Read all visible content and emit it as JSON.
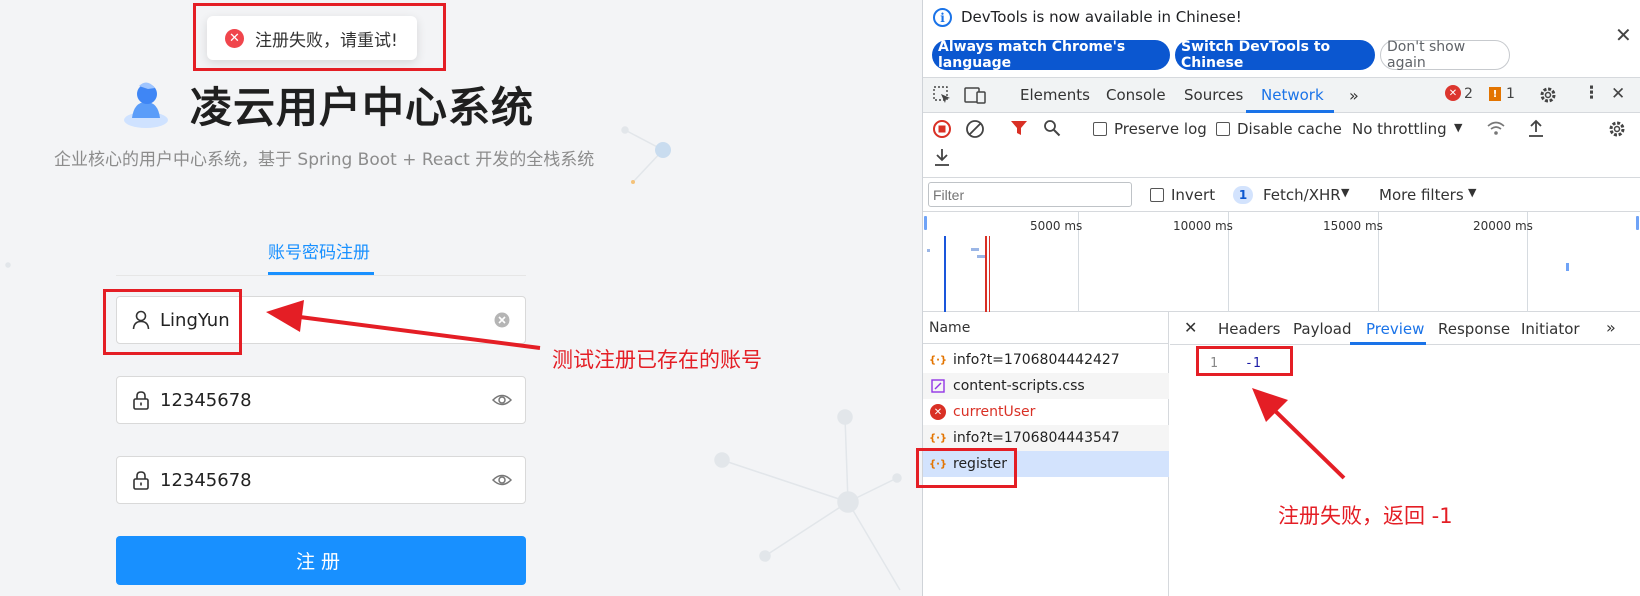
{
  "app": {
    "toast_message": "注册失败，请重试!",
    "title": "凌云用户中心系统",
    "subtitle": "企业核心的用户中心系统，基于 Spring Boot + React 开发的全栈系统",
    "tab_label": "账号密码注册",
    "username_value": "LingYun",
    "password_value": "12345678",
    "confirm_password_value": "12345678",
    "submit_label": "注册",
    "brand_color": "#1890ff"
  },
  "devtools": {
    "info_text": "DevTools is now available in Chinese!",
    "btn_match_language": "Always match Chrome's language",
    "btn_switch_chinese": "Switch DevTools to Chinese",
    "btn_dont_show": "Don't show again",
    "tabs": [
      "Elements",
      "Console",
      "Sources",
      "Network"
    ],
    "active_tab": "Network",
    "error_count": "2",
    "warning_count": "1",
    "preserve_log": "Preserve log",
    "disable_cache": "Disable cache",
    "throttling": "No throttling",
    "filter_placeholder": "Filter",
    "invert": "Invert",
    "resource_filter_count": "1",
    "resource_filter": "Fetch/XHR",
    "more_filters": "More filters",
    "timeline_ticks": [
      "5000 ms",
      "10000 ms",
      "15000 ms",
      "20000 ms"
    ],
    "name_header": "Name",
    "requests": [
      {
        "name": "info?t=1706804442427",
        "status": "ok",
        "icon": "xhr-icon"
      },
      {
        "name": "content-scripts.css",
        "status": "ok",
        "icon": "stylesheet-icon"
      },
      {
        "name": "currentUser",
        "status": "error",
        "icon": "error-icon"
      },
      {
        "name": "info?t=1706804443547",
        "status": "ok",
        "icon": "xhr-icon"
      },
      {
        "name": "register",
        "status": "selected",
        "icon": "xhr-icon"
      }
    ],
    "detail_tabs": [
      "Headers",
      "Payload",
      "Preview",
      "Response",
      "Initiator"
    ],
    "active_detail_tab": "Preview",
    "preview_line_number": "1",
    "preview_value": "-1"
  },
  "annotations": {
    "existing_account_note": "测试注册已存在的账号",
    "register_failed_note": "注册失败，返回 -1",
    "color": "#e41e25"
  }
}
